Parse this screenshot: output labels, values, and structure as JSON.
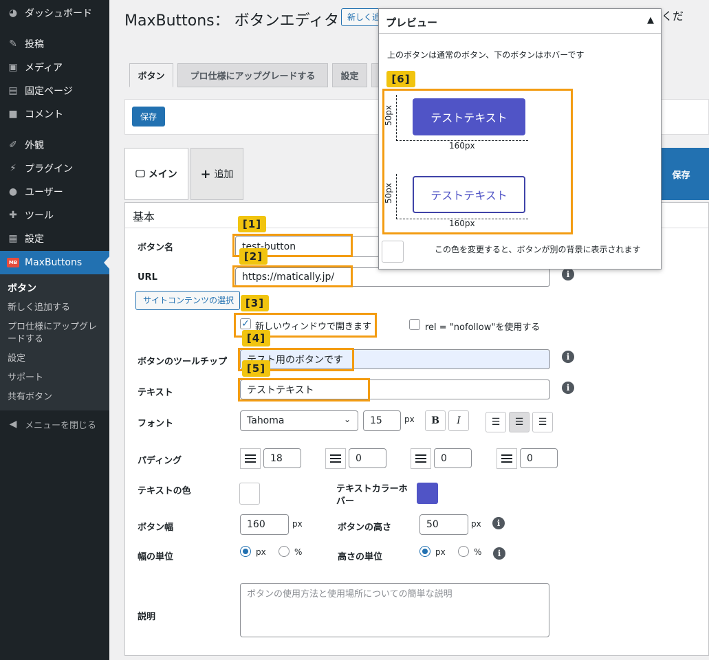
{
  "sidebar": {
    "items": [
      {
        "label": "ダッシュボード",
        "icon": "dashboard-icon"
      },
      {
        "label": "投稿",
        "icon": "pin-icon"
      },
      {
        "label": "メディア",
        "icon": "media-icon"
      },
      {
        "label": "固定ページ",
        "icon": "page-icon"
      },
      {
        "label": "コメント",
        "icon": "comment-icon"
      },
      {
        "label": "外観",
        "icon": "brush-icon"
      },
      {
        "label": "プラグイン",
        "icon": "plug-icon"
      },
      {
        "label": "ユーザー",
        "icon": "user-icon"
      },
      {
        "label": "ツール",
        "icon": "wrench-icon"
      },
      {
        "label": "設定",
        "icon": "settings-icon"
      },
      {
        "label": "MaxButtons",
        "icon": "maxbuttons-logo"
      }
    ],
    "logo_text": "MB",
    "submenu": [
      "ボタン",
      "新しく追加する",
      "プロ仕様にアップグレードする",
      "設定",
      "サポート",
      "共有ボタン"
    ],
    "collapse": "メニューを閉じる"
  },
  "header": {
    "title": "MaxButtons： ボタンエディタ",
    "add_new": "新しく追加する",
    "title_tail": "くだ"
  },
  "tabs": [
    "ボタン",
    "プロ仕様にアップグレードする",
    "設定"
  ],
  "save_label": "保存",
  "main_tabs": {
    "main": "メイン",
    "add": "追加"
  },
  "section_title": "基本",
  "form": {
    "name_label": "ボタン名",
    "name_value": "test-button",
    "url_label": "URL",
    "url_value": "https://matically.jp/",
    "site_content_btn": "サイトコンテンツの選択",
    "new_window": "新しいウィンドウで開きます",
    "nofollow": "rel = \"nofollow\"を使用する",
    "tooltip_label": "ボタンのツールチップ",
    "tooltip_value": "テスト用のボタンです",
    "text_label": "テキスト",
    "text_value": "テストテキスト",
    "font_label": "フォント",
    "font_value": "Tahoma",
    "font_size": "15",
    "px": "px",
    "bold": "B",
    "italic": "I",
    "padding_label": "パディング",
    "padding_values": [
      "18",
      "0",
      "0",
      "0"
    ],
    "text_color_label": "テキストの色",
    "text_color_hover_label": "テキストカラーホバー",
    "hover_color": "#5054c6",
    "width_label": "ボタン幅",
    "width_value": "160",
    "height_label": "ボタンの高さ",
    "height_value": "50",
    "width_unit_label": "幅の単位",
    "height_unit_label": "高さの単位",
    "unit_px": "px",
    "unit_pct": "%",
    "desc_label": "説明",
    "desc_placeholder": "ボタンの使用方法と使用場所についての簡単な説明",
    "info_symbol": "i"
  },
  "annotations": [
    "[1]",
    "[2]",
    "[3]",
    "[4]",
    "[5]",
    "[6]"
  ],
  "preview": {
    "title": "プレビュー",
    "toggle": "▲",
    "note": "上のボタンは通常のボタン、下のボタンはホバーです",
    "button_text": "テストテキスト",
    "width_dim": "160px",
    "height_dim": "50px",
    "bg_note": "この色を変更すると、ボタンが別の背景に表示されます",
    "normal_color": "#5054c6",
    "hover_border": "#3f43a8"
  }
}
